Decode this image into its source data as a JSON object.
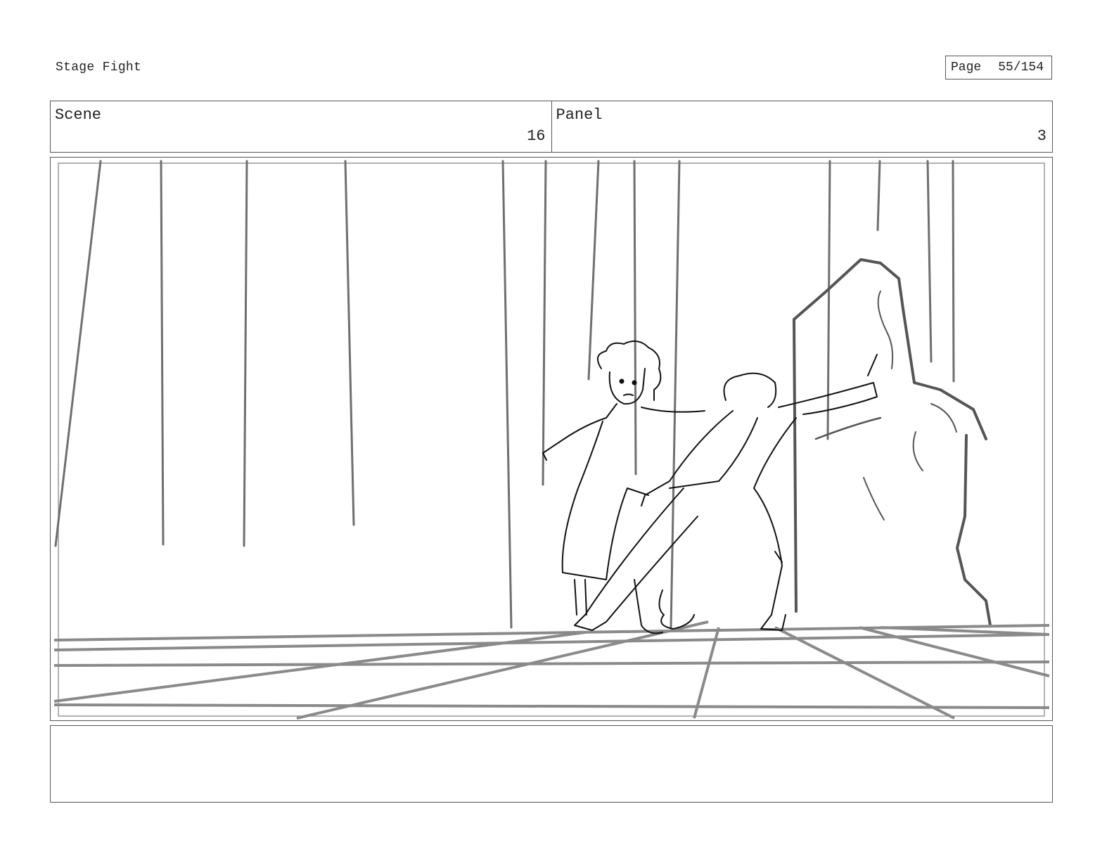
{
  "header": {
    "project_title": "Stage Fight",
    "page_label": "Page",
    "page_number": "55/154"
  },
  "info": {
    "scene_label": "Scene",
    "scene_number": "16",
    "panel_label": "Panel",
    "panel_number": "3"
  },
  "notes": {
    "text": ""
  }
}
